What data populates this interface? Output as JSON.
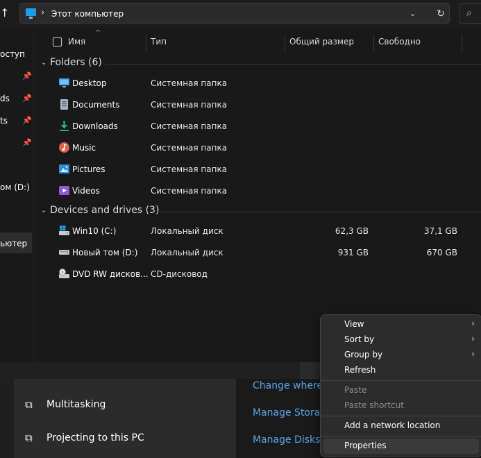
{
  "address": {
    "path_label": "Этот компьютер",
    "chevron": "›",
    "dropdown_glyph": "⌄",
    "refresh_glyph": "↻",
    "search_glyph": "⌕",
    "up_glyph": "↑"
  },
  "sidebar": {
    "items": [
      {
        "label": "оступ",
        "pinned": false
      },
      {
        "label": "ds",
        "pinned": true
      },
      {
        "label": "ts",
        "pinned": true
      },
      {
        "label": "",
        "pinned": true
      },
      {
        "label": "ом (D:)",
        "pinned": false
      },
      {
        "label": "ьютер",
        "pinned": false,
        "selected": true
      }
    ],
    "pin_glyph": "📌"
  },
  "columns": {
    "name": "Имя",
    "type": "Тип",
    "total": "Общий размер",
    "free": "Свободно"
  },
  "groups": {
    "folders": {
      "title": "Folders (6)",
      "items": [
        {
          "name": "Desktop",
          "type": "Системная папка",
          "icon": "desktop-icon"
        },
        {
          "name": "Documents",
          "type": "Системная папка",
          "icon": "documents-icon"
        },
        {
          "name": "Downloads",
          "type": "Системная папка",
          "icon": "downloads-icon"
        },
        {
          "name": "Music",
          "type": "Системная папка",
          "icon": "music-icon"
        },
        {
          "name": "Pictures",
          "type": "Системная папка",
          "icon": "pictures-icon"
        },
        {
          "name": "Videos",
          "type": "Системная папка",
          "icon": "videos-icon"
        }
      ]
    },
    "drives": {
      "title": "Devices and drives (3)",
      "items": [
        {
          "name": "Win10 (C:)",
          "type": "Локальный диск",
          "total": "62,3 GB",
          "free": "37,1 GB",
          "icon": "windows-drive-icon"
        },
        {
          "name": "Новый том (D:)",
          "type": "Локальный диск",
          "total": "931 GB",
          "free": "670 GB",
          "icon": "drive-icon"
        },
        {
          "name": "DVD RW дисков...",
          "type": "CD-дисковод",
          "total": "",
          "free": "",
          "icon": "dvd-drive-icon"
        }
      ]
    }
  },
  "settings": {
    "items": [
      {
        "label": "Multitasking",
        "icon": "multitasking-icon"
      },
      {
        "label": "Projecting to this PC",
        "icon": "projecting-icon"
      }
    ],
    "links": [
      "Change where n",
      "Manage Storage",
      "Manage Disks a"
    ]
  },
  "context_menu": {
    "items": [
      {
        "label": "View",
        "submenu": true,
        "disabled": false
      },
      {
        "label": "Sort by",
        "submenu": true,
        "disabled": false
      },
      {
        "label": "Group by",
        "submenu": true,
        "disabled": false
      },
      {
        "label": "Refresh",
        "submenu": false,
        "disabled": false
      },
      {
        "label": "Paste",
        "submenu": false,
        "disabled": true
      },
      {
        "label": "Paste shortcut",
        "submenu": false,
        "disabled": true
      },
      {
        "label": "Add a network location",
        "submenu": false,
        "disabled": false
      },
      {
        "label": "Properties",
        "submenu": false,
        "disabled": false,
        "highlighted": true
      }
    ],
    "submenu_glyph": "›"
  },
  "colors": {
    "background": "#191919",
    "menu_background": "#2c2c2c",
    "link": "#5aa3e8",
    "accent_blue": "#1e9ce8"
  }
}
